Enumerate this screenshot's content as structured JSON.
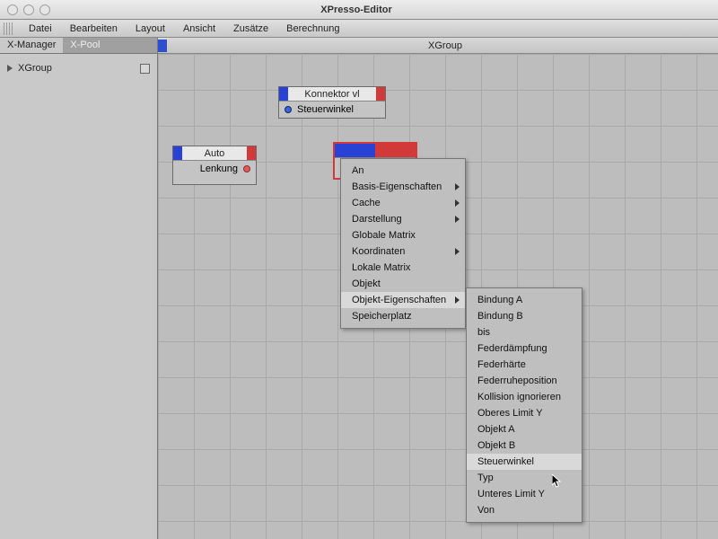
{
  "window": {
    "title": "XPresso-Editor"
  },
  "menubar": [
    "Datei",
    "Bearbeiten",
    "Layout",
    "Ansicht",
    "Zusätze",
    "Berechnung"
  ],
  "sidebar": {
    "tabs": [
      "X-Manager",
      "X-Pool"
    ],
    "active_tab": 0,
    "tree_item": "XGroup"
  },
  "canvas_header": "XGroup",
  "nodes": {
    "konnektor": {
      "title": "Konnektor vl",
      "port": "Steuerwinkel"
    },
    "auto": {
      "title": "Auto",
      "port": "Lenkung"
    }
  },
  "context_menu": {
    "items": [
      {
        "label": "An",
        "has_sub": false
      },
      {
        "label": "Basis-Eigenschaften",
        "has_sub": true
      },
      {
        "label": "Cache",
        "has_sub": true
      },
      {
        "label": "Darstellung",
        "has_sub": true
      },
      {
        "label": "Globale Matrix",
        "has_sub": false
      },
      {
        "label": "Koordinaten",
        "has_sub": true
      },
      {
        "label": "Lokale Matrix",
        "has_sub": false
      },
      {
        "label": "Objekt",
        "has_sub": false
      },
      {
        "label": "Objekt-Eigenschaften",
        "has_sub": true,
        "hover": true
      },
      {
        "label": "Speicherplatz",
        "has_sub": false
      }
    ]
  },
  "submenu": {
    "items": [
      "Bindung A",
      "Bindung B",
      "bis",
      "Federdämpfung",
      "Federhärte",
      "Federruheposition",
      "Kollision ignorieren",
      "Oberes Limit Y",
      "Objekt A",
      "Objekt B",
      "Steuerwinkel",
      "Typ",
      "Unteres Limit Y",
      "Von"
    ],
    "hover_index": 10
  }
}
